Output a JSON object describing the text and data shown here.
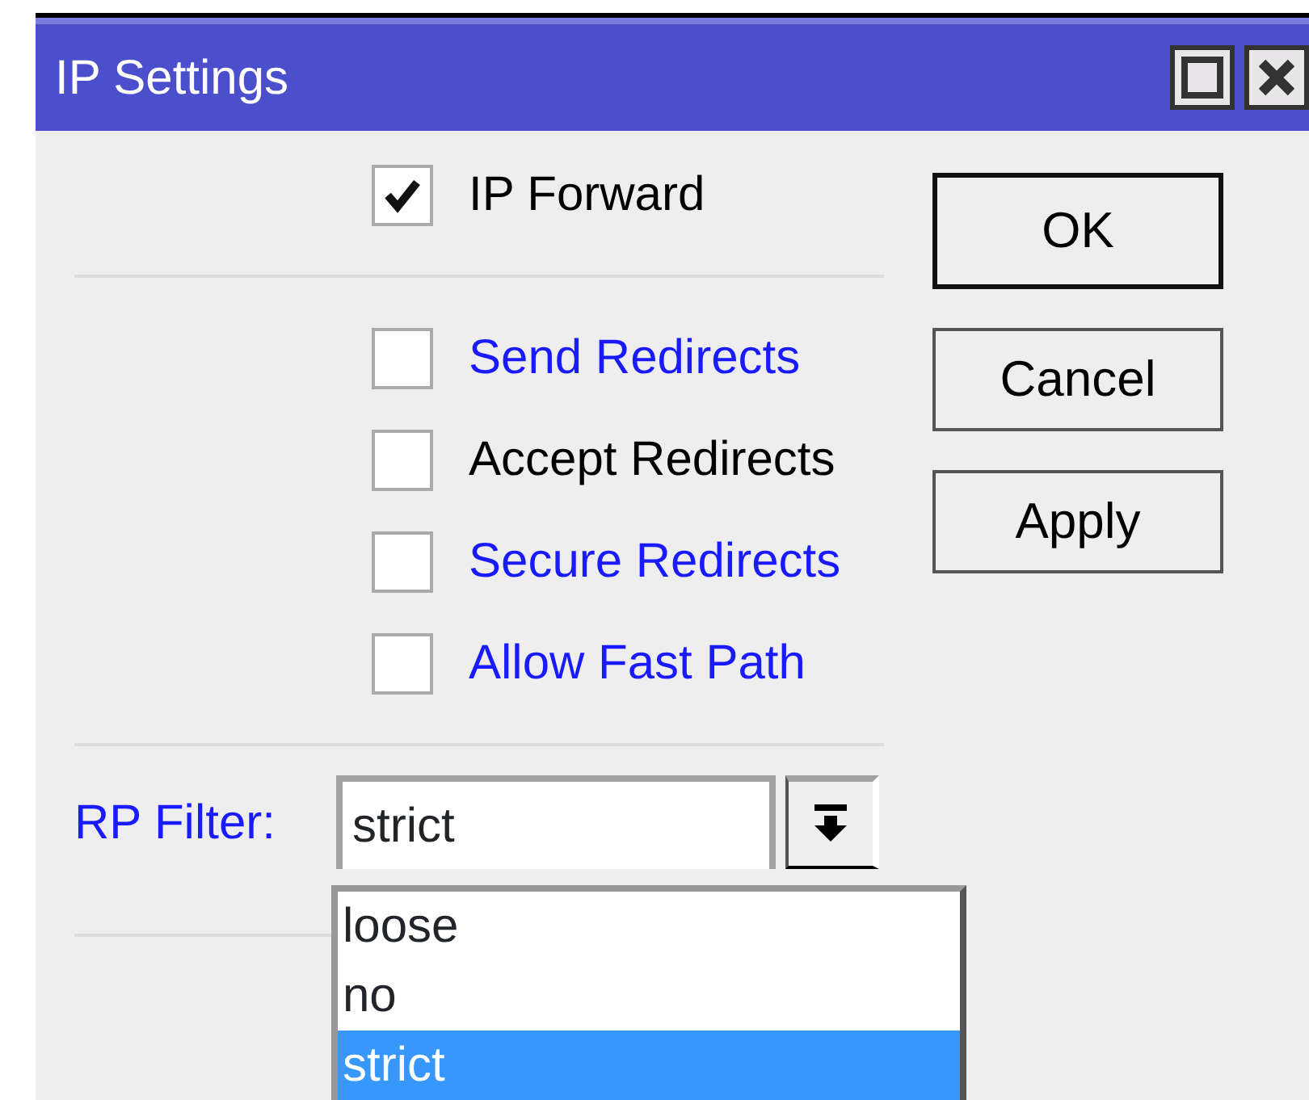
{
  "window": {
    "title": "IP Settings"
  },
  "checkbox_groups": [
    [
      {
        "label": "IP Forward",
        "checked": true,
        "color": "#000000"
      }
    ],
    [
      {
        "label": "Send Redirects",
        "checked": false,
        "color": "#1a1aff"
      },
      {
        "label": "Accept Redirects",
        "checked": false,
        "color": "#000000"
      },
      {
        "label": "Secure Redirects",
        "checked": false,
        "color": "#1a1aff"
      },
      {
        "label": "Allow Fast Path",
        "checked": false,
        "color": "#1a1aff"
      }
    ]
  ],
  "rp_filter": {
    "label": "RP Filter:",
    "value": "strict",
    "expanded": true,
    "options": [
      {
        "label": "loose",
        "selected": false
      },
      {
        "label": "no",
        "selected": false
      },
      {
        "label": "strict",
        "selected": true
      }
    ]
  },
  "buttons": [
    {
      "label": "OK",
      "default": true
    },
    {
      "label": "Cancel",
      "default": false
    },
    {
      "label": "Apply",
      "default": false
    }
  ]
}
